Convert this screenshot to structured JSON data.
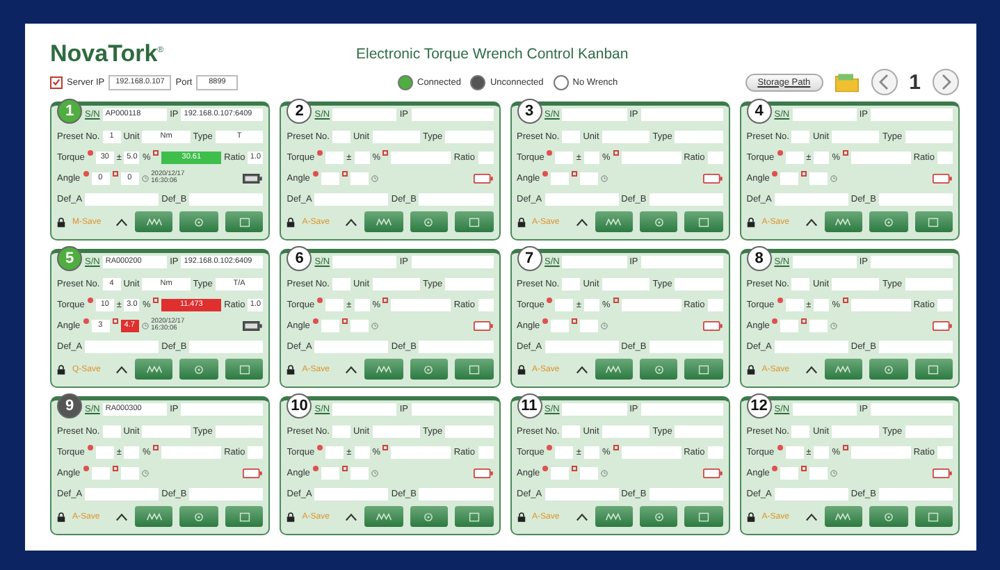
{
  "logo": "NovaTork$^{®}$",
  "title": "Electronic Torque Wrench Control Kanban",
  "server": {
    "checked": true,
    "ip_label": "Server IP",
    "ip": "192.168.0.107",
    "port_label": "Port",
    "port": "8899"
  },
  "legend": [
    {
      "color": "#4fae3f",
      "label": "Connected"
    },
    {
      "color": "#555555",
      "label": "Unconnected"
    },
    {
      "color": "#ffffff",
      "label": "No Wrench"
    }
  ],
  "storage_button": "Storage Path",
  "page": "1",
  "cards": [
    {
      "number": "1",
      "color": "#4fae3f",
      "labels": {
        "sn": "S/N",
        "ip": "IP",
        "preset": "Preset No.",
        "unit": "Unit",
        "type": "Type",
        "torque": "Torque",
        "plusminus": "±",
        "percent": "%",
        "ratio": "Ratio",
        "angle": "Angle",
        "def_a": "Def_A",
        "def_b": "Def_B"
      },
      "sn": "AP000118",
      "ip": "192.168.0.107:6409",
      "preset": "1",
      "unit": "Nm",
      "type": "T",
      "torque": "30",
      "tolerance": "5.0",
      "torque_result": {
        "text": "30.61",
        "color": "#3fbe4c"
      },
      "ratio": "1.0",
      "angle": "0",
      "angle_result": {
        "text": "0"
      },
      "date": "2020/12/17",
      "time": "16:30:06",
      "battery": true,
      "save": "M-Save"
    },
    {
      "number": "2",
      "color": "#ffffff",
      "labels": {
        "sn": "S/N",
        "ip": "IP",
        "preset": "Preset No.",
        "unit": "Unit",
        "type": "Type",
        "torque": "Torque",
        "plusminus": "±",
        "percent": "%",
        "ratio": "Ratio",
        "angle": "Angle",
        "def_a": "Def_A",
        "def_b": "Def_B"
      },
      "battery": false,
      "save": "A-Save"
    },
    {
      "number": "3",
      "color": "#ffffff",
      "labels": {
        "sn": "S/N",
        "ip": "IP",
        "preset": "Preset No.",
        "unit": "Unit",
        "type": "Type",
        "torque": "Torque",
        "plusminus": "±",
        "percent": "%",
        "ratio": "Ratio",
        "angle": "Angle",
        "def_a": "Def_A",
        "def_b": "Def_B"
      },
      "battery": false,
      "save": "A-Save"
    },
    {
      "number": "4",
      "color": "#ffffff",
      "labels": {
        "sn": "S/N",
        "ip": "IP",
        "preset": "Preset No.",
        "unit": "Unit",
        "type": "Type",
        "torque": "Torque",
        "plusminus": "±",
        "percent": "%",
        "ratio": "Ratio",
        "angle": "Angle",
        "def_a": "Def_A",
        "def_b": "Def_B"
      },
      "battery": false,
      "save": "A-Save"
    },
    {
      "number": "5",
      "color": "#4fae3f",
      "labels": {
        "sn": "S/N",
        "ip": "IP",
        "preset": "Preset No.",
        "unit": "Unit",
        "type": "Type",
        "torque": "Torque",
        "plusminus": "±",
        "percent": "%",
        "ratio": "Ratio",
        "angle": "Angle",
        "def_a": "Def_A",
        "def_b": "Def_B"
      },
      "sn": "RA000200",
      "ip": "192.168.0.102:6409",
      "preset": "4",
      "unit": "Nm",
      "type": "T/A",
      "torque": "10",
      "tolerance": "3.0",
      "torque_result": {
        "text": "11.473",
        "color": "#e02f2f"
      },
      "ratio": "1.0",
      "angle": "3",
      "angle_result": {
        "text": "4.7",
        "color": "#e02f2f"
      },
      "date": "2020/12/17",
      "time": "16:30:06",
      "battery": true,
      "save": "Q-Save"
    },
    {
      "number": "6",
      "color": "#ffffff",
      "labels": {
        "sn": "S/N",
        "ip": "IP",
        "preset": "Preset No.",
        "unit": "Unit",
        "type": "Type",
        "torque": "Torque",
        "plusminus": "±",
        "percent": "%",
        "ratio": "Ratio",
        "angle": "Angle",
        "def_a": "Def_A",
        "def_b": "Def_B"
      },
      "battery": false,
      "save": "A-Save"
    },
    {
      "number": "7",
      "color": "#ffffff",
      "labels": {
        "sn": "S/N",
        "ip": "IP",
        "preset": "Preset No.",
        "unit": "Unit",
        "type": "Type",
        "torque": "Torque",
        "plusminus": "±",
        "percent": "%",
        "ratio": "Ratio",
        "angle": "Angle",
        "def_a": "Def_A",
        "def_b": "Def_B"
      },
      "battery": false,
      "save": "A-Save"
    },
    {
      "number": "8",
      "color": "#ffffff",
      "labels": {
        "sn": "S/N",
        "ip": "IP",
        "preset": "Preset No.",
        "unit": "Unit",
        "type": "Type",
        "torque": "Torque",
        "plusminus": "±",
        "percent": "%",
        "ratio": "Ratio",
        "angle": "Angle",
        "def_a": "Def_A",
        "def_b": "Def_B"
      },
      "battery": false,
      "save": "A-Save"
    },
    {
      "number": "9",
      "color": "#555555",
      "labels": {
        "sn": "S/N",
        "ip": "IP",
        "preset": "Preset No.",
        "unit": "Unit",
        "type": "Type",
        "torque": "Torque",
        "plusminus": "±",
        "percent": "%",
        "ratio": "Ratio",
        "angle": "Angle",
        "def_a": "Def_A",
        "def_b": "Def_B"
      },
      "sn": "RA000300",
      "battery": false,
      "save": "A-Save"
    },
    {
      "number": "10",
      "color": "#ffffff",
      "labels": {
        "sn": "S/N",
        "ip": "IP",
        "preset": "Preset No.",
        "unit": "Unit",
        "type": "Type",
        "torque": "Torque",
        "plusminus": "±",
        "percent": "%",
        "ratio": "Ratio",
        "angle": "Angle",
        "def_a": "Def_A",
        "def_b": "Def_B"
      },
      "battery": false,
      "save": "A-Save"
    },
    {
      "number": "11",
      "color": "#ffffff",
      "labels": {
        "sn": "S/N",
        "ip": "IP",
        "preset": "Preset No.",
        "unit": "Unit",
        "type": "Type",
        "torque": "Torque",
        "plusminus": "±",
        "percent": "%",
        "ratio": "Ratio",
        "angle": "Angle",
        "def_a": "Def_A",
        "def_b": "Def_B"
      },
      "battery": false,
      "save": "A-Save"
    },
    {
      "number": "12",
      "color": "#ffffff",
      "labels": {
        "sn": "S/N",
        "ip": "IP",
        "preset": "Preset No.",
        "unit": "Unit",
        "type": "Type",
        "torque": "Torque",
        "plusminus": "±",
        "percent": "%",
        "ratio": "Ratio",
        "angle": "Angle",
        "def_a": "Def_A",
        "def_b": "Def_B"
      },
      "battery": false,
      "save": "A-Save"
    }
  ]
}
